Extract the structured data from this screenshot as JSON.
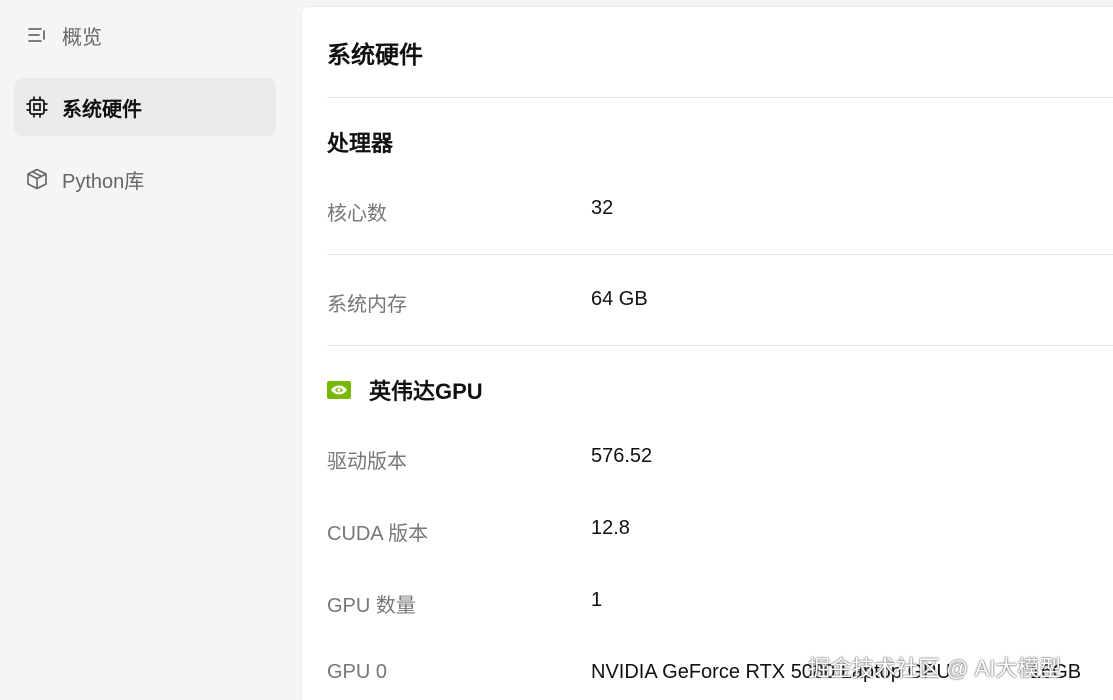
{
  "sidebar": {
    "items": [
      {
        "label": "概览",
        "icon": "list-menu-icon"
      },
      {
        "label": "系统硬件",
        "icon": "chip-icon",
        "active": true
      },
      {
        "label": "Python库",
        "icon": "package-box-icon"
      }
    ]
  },
  "main": {
    "title": "系统硬件",
    "processor": {
      "section_title": "处理器",
      "rows": [
        {
          "label": "核心数",
          "value": "32"
        },
        {
          "label": "系统内存",
          "value": "64 GB"
        }
      ]
    },
    "gpu": {
      "section_title": "英伟达GPU",
      "icon": "nvidia-logo-icon",
      "rows": [
        {
          "label": "驱动版本",
          "value": "576.52"
        },
        {
          "label": "CUDA 版本",
          "value": "12.8"
        },
        {
          "label": "GPU 数量",
          "value": "1"
        },
        {
          "label": "GPU 0",
          "value": "NVIDIA GeForce RTX 5080 Laptop GPU",
          "extra": "16GB"
        }
      ]
    }
  },
  "watermark": "掘金技术社区 @ AI大模型",
  "colors": {
    "nvidia_green": "#76b900",
    "active_bg": "#ebebeb"
  }
}
